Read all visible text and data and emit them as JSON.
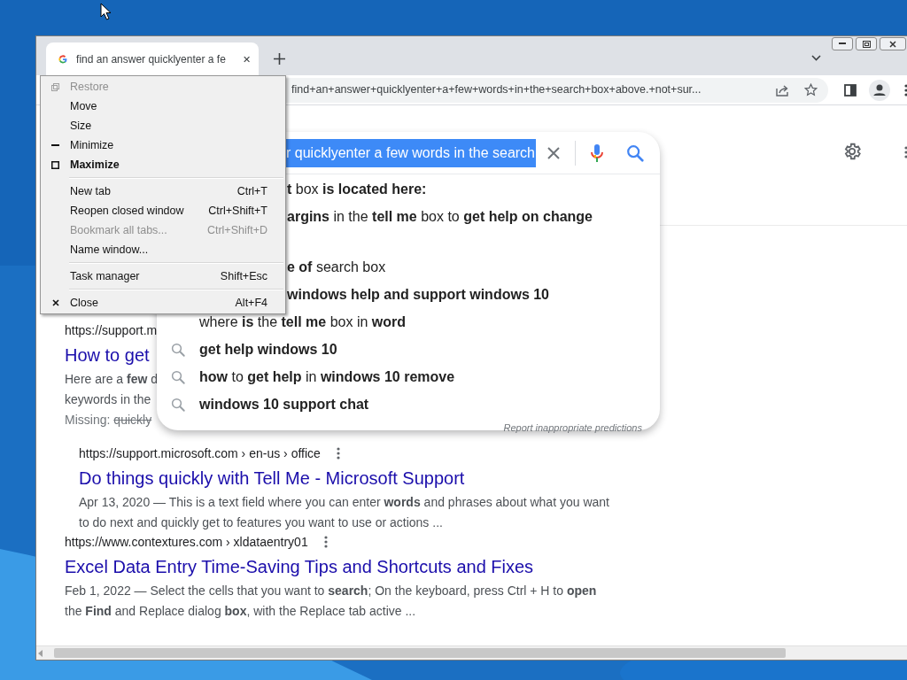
{
  "browser": {
    "tab": {
      "title": "find an answer quicklyenter a fe",
      "selected": true
    },
    "address": "find+an+answer+quicklyenter+a+few+words+in+the+search+box+above.+not+sur..."
  },
  "search": {
    "selected_text": "r quicklyenter a few words in the search",
    "suggestions": [
      {
        "kind": "covered",
        "text": "**t** box **is located here:**"
      },
      {
        "kind": "covered",
        "text": "**argins** in the **tell me** box to **get help on change**"
      },
      {
        "kind": "covered",
        "text": "**e of** search box"
      },
      {
        "kind": "covered",
        "text": "**windows help and support windows 10**"
      },
      {
        "kind": "full",
        "text": "where **is** the **tell me** box in **word**"
      },
      {
        "kind": "full",
        "text": "**get help windows 10**"
      },
      {
        "kind": "full",
        "text": "**how** to **get help** in **windows 10 remove**"
      },
      {
        "kind": "full",
        "text": "**windows 10 support chat**"
      }
    ],
    "report_link": "Report inappropriate predictions"
  },
  "results": [
    {
      "url": "https://support.m",
      "title": "How to get",
      "snippet": [
        "Here are a **few** d",
        "keywords in the"
      ],
      "missing_label": "Missing:",
      "missing": "quickly",
      "children": [
        {
          "url": "https://support.microsoft.com › en-us › office",
          "title": "Do things quickly with Tell Me - Microsoft Support",
          "snippet": [
            "Apr 13, 2020 — This is a text field where you can enter **words** and phrases about what you want to do next and quickly get to features you want to use or actions ..."
          ]
        }
      ]
    },
    {
      "url": "https://www.contextures.com › xldataentry01",
      "title": "Excel Data Entry Time-Saving Tips and Shortcuts and Fixes",
      "snippet": [
        "Feb 1, 2022 — Select the cells that you want to **search**; On the keyboard, press Ctrl + H to **open** the **Find** and Replace dialog **box**, with the Replace tab active ..."
      ]
    }
  ],
  "system_menu": [
    {
      "kind": "restore",
      "label": "Restore",
      "disabled": true,
      "default": false
    },
    {
      "kind": "item",
      "label": "Move",
      "disabled": false,
      "default": false
    },
    {
      "kind": "item",
      "label": "Size",
      "disabled": false,
      "default": false
    },
    {
      "kind": "minimize",
      "label": "Minimize",
      "disabled": false,
      "default": false
    },
    {
      "kind": "maximize",
      "label": "Maximize",
      "disabled": false,
      "default": true
    },
    {
      "kind": "separator"
    },
    {
      "kind": "item",
      "label": "New tab",
      "shortcut": "Ctrl+T",
      "disabled": false,
      "default": false
    },
    {
      "kind": "item",
      "label": "Reopen closed window",
      "shortcut": "Ctrl+Shift+T",
      "disabled": false,
      "default": false
    },
    {
      "kind": "item",
      "label": "Bookmark all tabs...",
      "shortcut": "Ctrl+Shift+D",
      "disabled": true,
      "default": false
    },
    {
      "kind": "item",
      "label": "Name window...",
      "disabled": false,
      "default": false
    },
    {
      "kind": "separator"
    },
    {
      "kind": "item",
      "label": "Task manager",
      "shortcut": "Shift+Esc",
      "disabled": false,
      "default": false
    },
    {
      "kind": "separator"
    },
    {
      "kind": "close",
      "label": "Close",
      "shortcut": "Alt+F4",
      "disabled": false,
      "default": false
    }
  ]
}
